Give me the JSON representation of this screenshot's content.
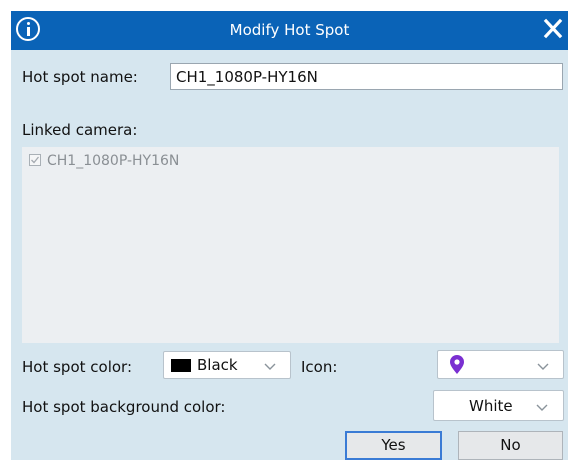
{
  "window": {
    "title": "Modify Hot Spot",
    "close_symbol": "✕"
  },
  "form": {
    "name_label": "Hot spot name:",
    "name_value": "CH1_1080P-HY16N",
    "linked_label": "Linked camera:",
    "linked_cameras": [
      {
        "label": "CH1_1080P-HY16N",
        "checked": true,
        "disabled": true
      }
    ],
    "color_label": "Hot spot color:",
    "color_value": "Black",
    "color_swatch": "#000000",
    "icon_label": "Icon:",
    "icon_value_name": "map-pin-icon",
    "icon_color": "#7a2fd1",
    "bg_color_label": "Hot spot background color:",
    "bg_color_value": "White",
    "bg_color_swatch": "#ffffff"
  },
  "buttons": {
    "yes": "Yes",
    "no": "No"
  },
  "theme": {
    "titlebar": "#0a63b7",
    "dialog_bg": "#d6e6ef",
    "default_button_border": "#3a7bd5"
  }
}
